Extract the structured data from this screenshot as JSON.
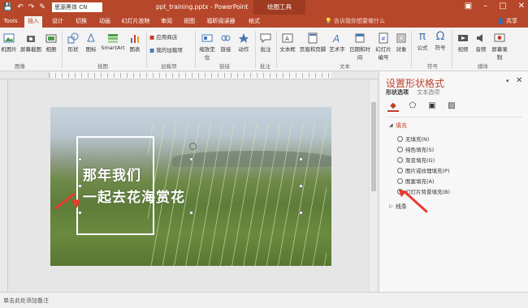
{
  "titlebar": {
    "font_box": "思源黑体 CN",
    "doc_title": "ppt_training.pptx - PowerPoint",
    "contextual": "绘图工具",
    "icons": [
      "save-icon",
      "undo-icon",
      "redo-icon",
      "brush-icon"
    ]
  },
  "tabs": {
    "items": [
      "Tools",
      "插入",
      "设计",
      "切换",
      "动画",
      "幻灯片放映",
      "审阅",
      "视图",
      "福昕阅读器",
      "格式"
    ],
    "active": "插入",
    "tell": "告诉我你想要做什么",
    "share": "共享"
  },
  "ribbon": {
    "buttons": [
      {
        "label": "机图片",
        "icon": "picture-icon"
      },
      {
        "label": "屏幕截图",
        "icon": "screenshot-icon"
      },
      {
        "label": "相册",
        "icon": "album-icon"
      },
      {
        "label": "形状",
        "icon": "shapes-icon"
      },
      {
        "label": "图标",
        "icon": "icons-icon"
      },
      {
        "label": "SmartArt",
        "icon": "smartart-icon"
      },
      {
        "label": "图表",
        "icon": "chart-icon"
      },
      {
        "label": "应用商店",
        "icon": "store-icon"
      },
      {
        "label": "我的加载项",
        "icon": "addins-icon"
      },
      {
        "label": "缩放定位",
        "icon": "zoom-icon"
      },
      {
        "label": "链接",
        "icon": "link-icon"
      },
      {
        "label": "动作",
        "icon": "action-icon"
      },
      {
        "label": "批注",
        "icon": "comment-icon"
      },
      {
        "label": "文本框",
        "icon": "textbox-icon"
      },
      {
        "label": "页眉和页脚",
        "icon": "header-footer-icon"
      },
      {
        "label": "艺术字",
        "icon": "wordart-icon"
      },
      {
        "label": "日期和时间",
        "icon": "datetime-icon"
      },
      {
        "label": "幻灯片编号",
        "icon": "slide-number-icon"
      },
      {
        "label": "对象",
        "icon": "object-icon"
      },
      {
        "label": "公式",
        "icon": "equation-icon"
      },
      {
        "label": "符号",
        "icon": "symbol-icon"
      },
      {
        "label": "视频",
        "icon": "video-icon"
      },
      {
        "label": "音频",
        "icon": "audio-icon"
      },
      {
        "label": "屏幕录制",
        "icon": "screen-record-icon"
      }
    ],
    "groups": [
      "图像",
      "插图",
      "加载项",
      "链接",
      "批注",
      "文本",
      "符号",
      "媒体"
    ]
  },
  "slide": {
    "line1": "那年我们",
    "line2": "一起去花海赏花"
  },
  "pane": {
    "title": "设置形状格式",
    "tab_shape": "形状选项",
    "tab_text": "文本选项",
    "icons": [
      "fill-line-icon",
      "effects-icon",
      "size-properties-icon",
      "picture-icon"
    ],
    "fill_section": "填充",
    "options": [
      {
        "label": "无填充(N)",
        "selected": false
      },
      {
        "label": "纯色填充(S)",
        "selected": false
      },
      {
        "label": "渐变填充(G)",
        "selected": false
      },
      {
        "label": "图片或纹理填充(P)",
        "selected": false
      },
      {
        "label": "图案填充(A)",
        "selected": false
      },
      {
        "label": "幻灯片背景填充(B)",
        "selected": true
      }
    ],
    "line_section": "线条"
  },
  "status": {
    "notes": "单击此处添加备注"
  }
}
